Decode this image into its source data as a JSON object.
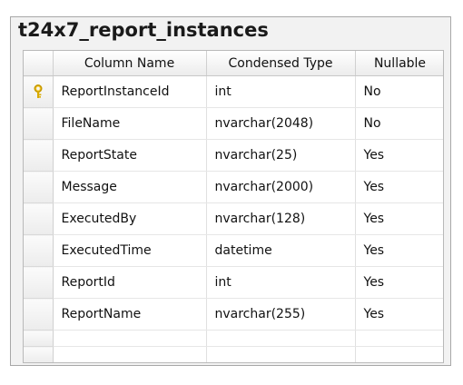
{
  "table": {
    "title": "t24x7_report_instances",
    "columns": [
      "Column Name",
      "Condensed Type",
      "Nullable"
    ],
    "rows": [
      {
        "name": "ReportInstanceId",
        "type": "int",
        "nullable": "No",
        "primary_key": true,
        "icon": "key-icon"
      },
      {
        "name": "FileName",
        "type": "nvarchar(2048)",
        "nullable": "No"
      },
      {
        "name": "ReportState",
        "type": "nvarchar(25)",
        "nullable": "Yes"
      },
      {
        "name": "Message",
        "type": "nvarchar(2000)",
        "nullable": "Yes"
      },
      {
        "name": "ExecutedBy",
        "type": "nvarchar(128)",
        "nullable": "Yes"
      },
      {
        "name": "ExecutedTime",
        "type": "datetime",
        "nullable": "Yes"
      },
      {
        "name": "ReportId",
        "type": "int",
        "nullable": "Yes"
      },
      {
        "name": "ReportName",
        "type": "nvarchar(255)",
        "nullable": "Yes"
      }
    ]
  },
  "colors": {
    "key_icon": "#e0b400",
    "border": "#a8a8a8",
    "panel_background": "#f2f2f2"
  }
}
